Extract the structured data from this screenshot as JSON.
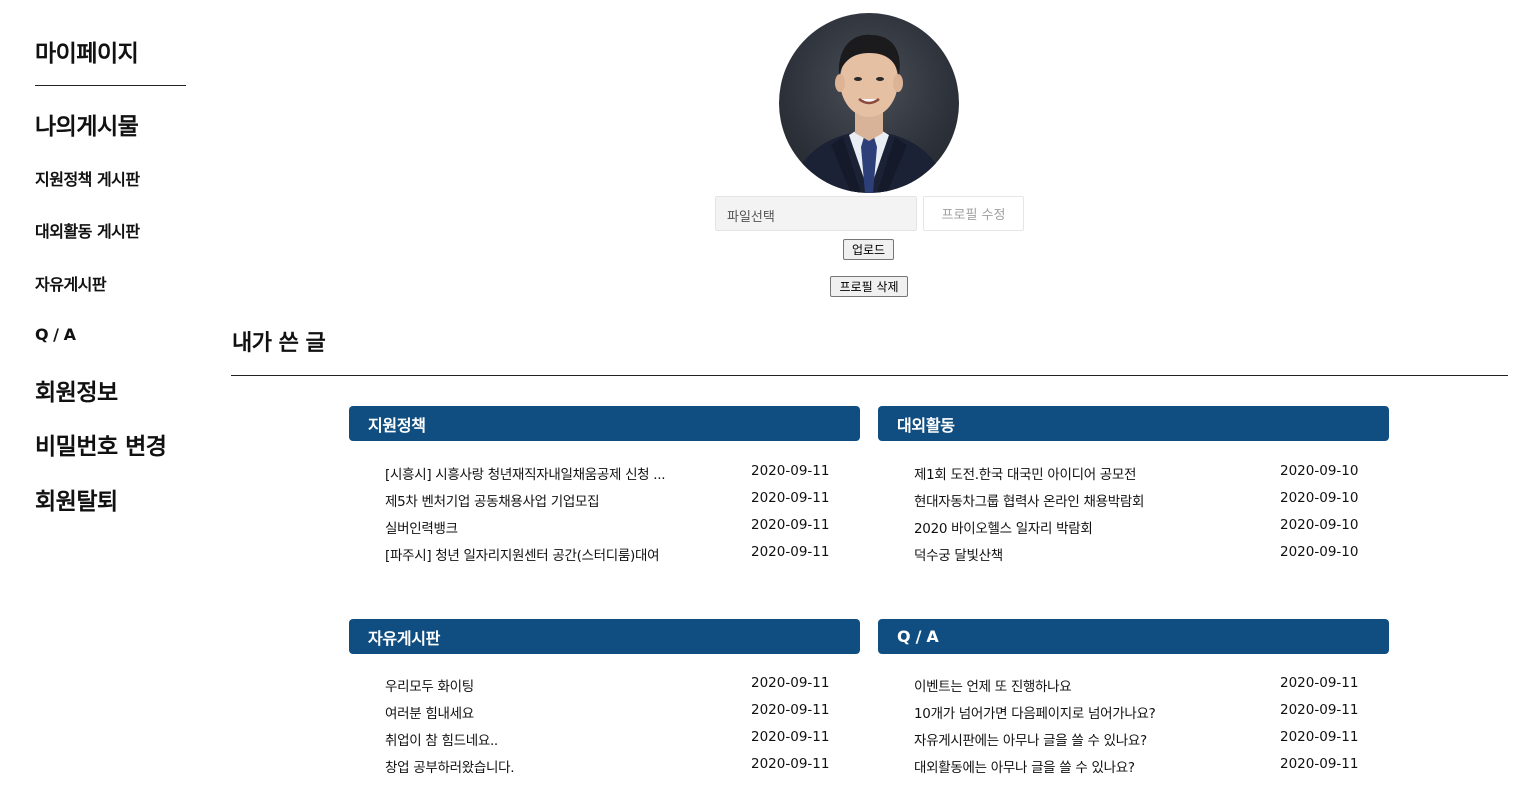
{
  "sidebar": {
    "title": "마이페이지",
    "posts_heading": "나의게시물",
    "items": [
      "지원정책 게시판",
      "대외활동 게시판",
      "자유게시판",
      "Q / A"
    ],
    "member_heading": "회원정보",
    "change_password": "비밀번호 변경",
    "withdraw": "회원탈퇴"
  },
  "profile": {
    "file_placeholder": "파일선택",
    "edit_label": "프로필 수정",
    "upload_label": "업로드",
    "delete_label": "프로필 삭제"
  },
  "my_posts": {
    "title": "내가 쓴 글",
    "panels": [
      {
        "header": "지원정책",
        "rows": [
          {
            "title": "[시흥시] 시흥사랑 청년재직자내일채움공제 신청 ...",
            "date": "2020-09-11"
          },
          {
            "title": "제5차 벤처기업 공동채용사업 기업모집",
            "date": "2020-09-11"
          },
          {
            "title": "실버인력뱅크",
            "date": "2020-09-11"
          },
          {
            "title": "[파주시] 청년 일자리지원센터 공간(스터디룸)대여",
            "date": "2020-09-11"
          }
        ]
      },
      {
        "header": "대외활동",
        "rows": [
          {
            "title": "제1회 도전.한국 대국민 아이디어 공모전",
            "date": "2020-09-10"
          },
          {
            "title": "현대자동차그룹 협력사 온라인 채용박람회",
            "date": "2020-09-10"
          },
          {
            "title": "2020 바이오헬스 일자리 박람회",
            "date": "2020-09-10"
          },
          {
            "title": "덕수궁 달빛산책",
            "date": "2020-09-10"
          }
        ]
      },
      {
        "header": "자유게시판",
        "rows": [
          {
            "title": "우리모두 화이팅",
            "date": "2020-09-11"
          },
          {
            "title": "여러분 힘내세요",
            "date": "2020-09-11"
          },
          {
            "title": "취업이 참 힘드네요..",
            "date": "2020-09-11"
          },
          {
            "title": "창업 공부하러왔습니다.",
            "date": "2020-09-11"
          }
        ]
      },
      {
        "header": "Q / A",
        "rows": [
          {
            "title": "이벤트는 언제 또 진행하나요",
            "date": "2020-09-11"
          },
          {
            "title": "10개가 넘어가면 다음페이지로 넘어가나요?",
            "date": "2020-09-11"
          },
          {
            "title": "자유게시판에는 아무나 글을 쓸 수 있나요?",
            "date": "2020-09-11"
          },
          {
            "title": "대외활동에는 아무나 글을 쓸 수 있나요?",
            "date": "2020-09-11"
          }
        ]
      }
    ]
  },
  "colors": {
    "panel_header": "#104e82"
  }
}
